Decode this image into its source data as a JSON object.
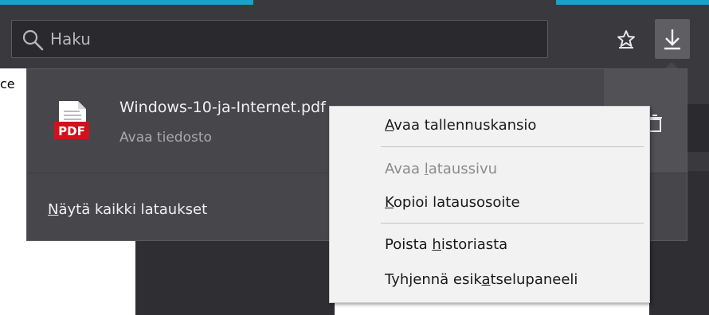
{
  "colors": {
    "accent": "#1aa3c8",
    "toolbar": "#3a393d",
    "panel": "#47464b",
    "menu": "#f2f2f2"
  },
  "search": {
    "placeholder": "Haku",
    "icon": "search-icon"
  },
  "toolbar": {
    "bookmark_icon": "bookmark-star-icon",
    "download_icon": "download-arrow-icon"
  },
  "background": {
    "left_fragment": "ce"
  },
  "downloads": {
    "file_name": "Windows-10-ja-Internet.pdf",
    "file_status": "Avaa tiedosto",
    "file_icon": "pdf-file-icon",
    "file_icon_label": "PDF",
    "show_all_prefix": "",
    "show_all_key": "N",
    "show_all_rest": "äytä kaikki lataukset"
  },
  "context_menu": {
    "items": [
      {
        "pre": "",
        "key": "A",
        "post": "vaa tallennuskansio",
        "enabled": true
      },
      {
        "pre": "Avaa ",
        "key": "l",
        "post": "ataussivu",
        "enabled": false
      },
      {
        "pre": "",
        "key": "K",
        "post": "opioi latausosoite",
        "enabled": true
      },
      {
        "pre": "Poista ",
        "key": "h",
        "post": "istoriasta",
        "enabled": true
      },
      {
        "pre": "Tyhjennä esik",
        "key": "a",
        "post": "tselupaneeli",
        "enabled": true
      }
    ]
  }
}
